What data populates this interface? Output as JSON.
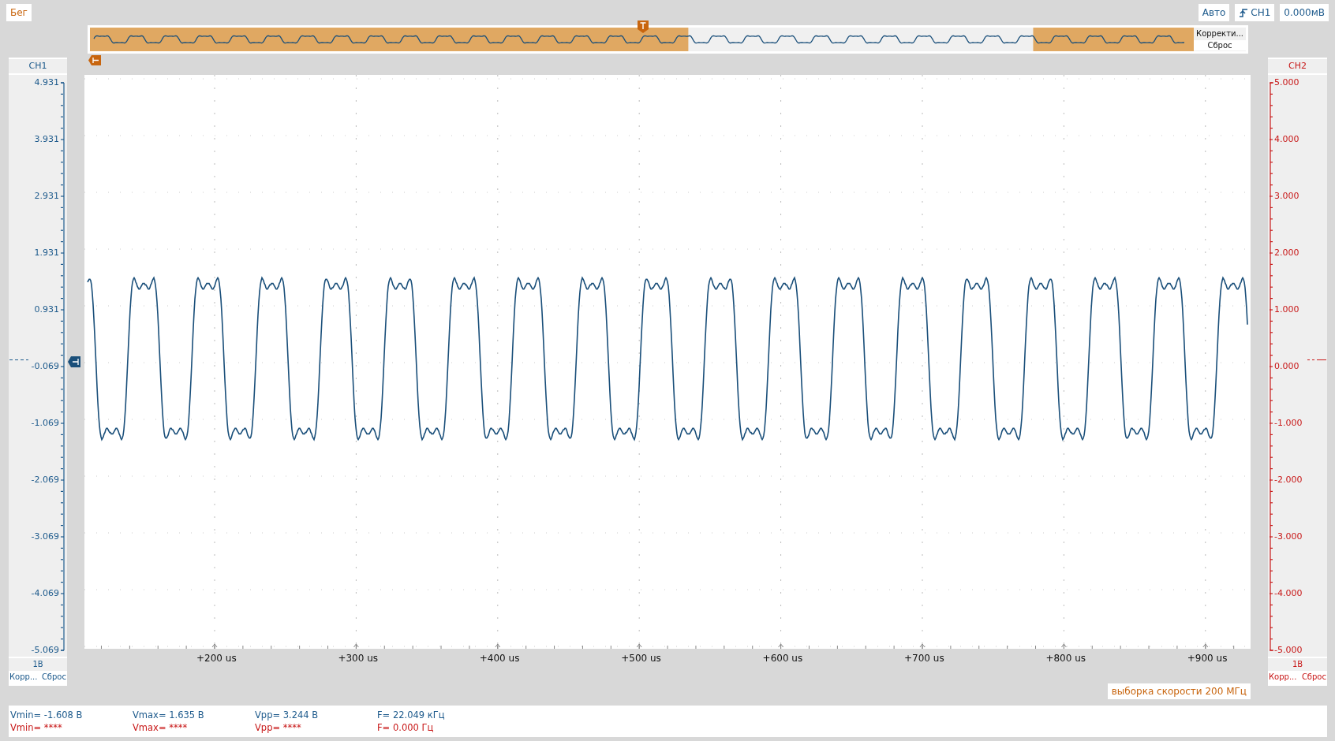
{
  "status": {
    "label": "Бег"
  },
  "trigger": {
    "mode": "Авто",
    "source": "CH1",
    "level": "0.000мВ"
  },
  "overview": {
    "buttons": [
      "Корректи...",
      "Сброс"
    ]
  },
  "channels": [
    {
      "name": "CH1",
      "color": "#1d5a8c",
      "kind": "left",
      "ticks": [
        "4.931",
        "3.931",
        "2.931",
        "1.931",
        "0.931",
        "-0.069",
        "-1.069",
        "-2.069",
        "-3.069",
        "-4.069",
        "-5.069"
      ],
      "scale": "1В",
      "buttons": [
        "Корр...",
        "Сброс"
      ]
    },
    {
      "name": "CH2",
      "color": "#c81818",
      "kind": "right",
      "ticks": [
        "5.000",
        "4.000",
        "3.000",
        "2.000",
        "1.000",
        "0.000",
        "-1.000",
        "-2.000",
        "-3.000",
        "-4.000",
        "-5.000"
      ],
      "scale": "1В",
      "buttons": [
        "Корр...",
        "Сброс"
      ]
    }
  ],
  "time_labels": [
    "+200 us",
    "+300 us",
    "+400 us",
    "+500 us",
    "+600 us",
    "+700 us",
    "+800 us",
    "+900 us"
  ],
  "sample_rate": "выборка скорости 200 МГц",
  "measurements": [
    {
      "color": "#1d5a8c",
      "values": [
        "Vmin= -1.608 В",
        "Vmax= 1.635 В",
        "Vpp= 3.244 В",
        "F= 22.049 кГц"
      ]
    },
    {
      "color": "#c81818",
      "values": [
        "Vmin= ****",
        "Vmax= ****",
        "Vpp= ****",
        "F= 0.000 Гц"
      ]
    }
  ]
}
